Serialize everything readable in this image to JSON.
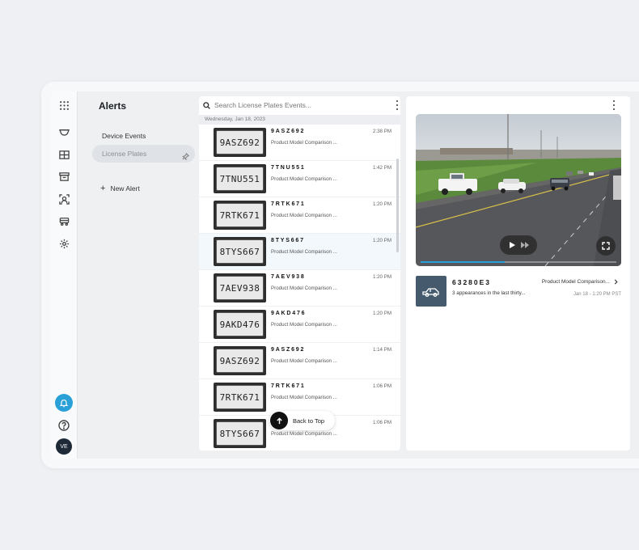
{
  "rail": {
    "icons": [
      "apps-grid-icon",
      "camera-icon",
      "layout-grid-icon",
      "archive-icon",
      "person-scan-icon",
      "vehicle-icon",
      "settings-icon"
    ],
    "avatar_initials": "VE"
  },
  "nav": {
    "title": "Alerts",
    "device_events": "Device Events",
    "license_plates": "License Plates",
    "new_alert": "New Alert"
  },
  "list": {
    "search_placeholder": "Search License Plates Events...",
    "date_header": "Wednesday, Jan 18, 2023",
    "rows": [
      {
        "plate_text": "9ASZ692",
        "title": "9ASZ692",
        "subtitle": "Product Model Comparison ...",
        "time": "2:38 PM"
      },
      {
        "plate_text": "7TNU551",
        "title": "7TNU551",
        "subtitle": "Product Model Comparison ...",
        "time": "1:42 PM"
      },
      {
        "plate_text": "7RTK671",
        "title": "7RTK671",
        "subtitle": "Product Model Comparison ...",
        "time": "1:20 PM"
      },
      {
        "plate_text": "8TYS667",
        "title": "8TYS667",
        "subtitle": "Product Model Comparison ...",
        "time": "1:20 PM"
      },
      {
        "plate_text": "7AEV938",
        "title": "7AEV938",
        "subtitle": "Product Model Comparison ...",
        "time": "1:20 PM"
      },
      {
        "plate_text": "9AKD476",
        "title": "9AKD476",
        "subtitle": "Product Model Comparison ...",
        "time": "1:20 PM"
      },
      {
        "plate_text": "9ASZ692",
        "title": "9ASZ692",
        "subtitle": "Product Model Comparison ...",
        "time": "1:14 PM"
      },
      {
        "plate_text": "7RTK671",
        "title": "7RTK671",
        "subtitle": "Product Model Comparison ...",
        "time": "1:06 PM"
      },
      {
        "plate_text": "8TYS667",
        "title": "8TYS667",
        "subtitle": "Product Model Comparison ...",
        "time": "1:06 PM"
      }
    ],
    "selected_index": 3,
    "back_to_top": "Back to Top"
  },
  "detail": {
    "video_progress": 0.43,
    "event": {
      "plate": "63280E3",
      "subtitle": "3 appearances in the last thirty...",
      "model": "Product Model Comparison...",
      "time": "Jan 18 - 1:20 PM PST"
    }
  },
  "colors": {
    "accent": "#2aa0d8",
    "truck_tile": "#455a6c"
  }
}
